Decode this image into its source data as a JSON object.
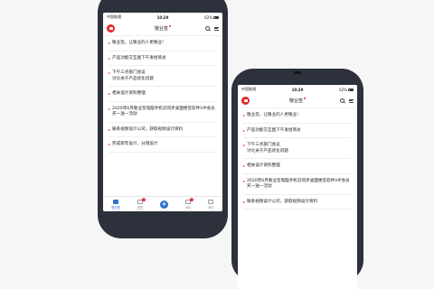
{
  "status": {
    "carrier": "中国联通",
    "time": "10:29",
    "battery": "62%"
  },
  "header": {
    "title": "敬业签"
  },
  "phone1_items": [
    {
      "title": "敬业签，让敬业的人更敬业!",
      "meta": ""
    },
    {
      "title": "产品功能交互图下午发给简总",
      "meta": ""
    },
    {
      "title": "下午三点部门会议\n讨论关于产品优化问题",
      "meta": ""
    },
    {
      "title": "相关设计资料整理",
      "meta": ""
    },
    {
      "title": "2020年6月敬业签电脑手机云同步桌面便签软件VIP会员买一送一活动",
      "meta": ""
    },
    {
      "title": "联系视频设计公司，获取视频设计资料",
      "meta": ""
    },
    {
      "title": "完成新年设计，分镜设计",
      "meta": ""
    }
  ],
  "phone2_items": [
    {
      "title": "敬业签，让敬业的人更敬业!",
      "meta": ""
    },
    {
      "title": "产品功能交互图下午发给简总",
      "meta": ""
    },
    {
      "title": "下午三点部门会议\n讨论关于产品优化问题",
      "meta": ""
    },
    {
      "title": "相关设计资料整理",
      "meta": ""
    },
    {
      "title": "2020年6月敬业签电脑手机云同步桌面便签软件VIP会员买一送一活动",
      "meta": ""
    },
    {
      "title": "联系视频设计公司，获取视频设计资料",
      "meta": ""
    }
  ],
  "tabs": [
    {
      "label": "敬业签",
      "active": true
    },
    {
      "label": "团签",
      "badge": "1"
    },
    {
      "label": "",
      "plus": true
    },
    {
      "label": "消息",
      "badge": "1"
    },
    {
      "label": "我的"
    }
  ],
  "colors": {
    "accent": "#2f6ec9",
    "brand": "#e02b27",
    "phone": "#2c313b"
  }
}
